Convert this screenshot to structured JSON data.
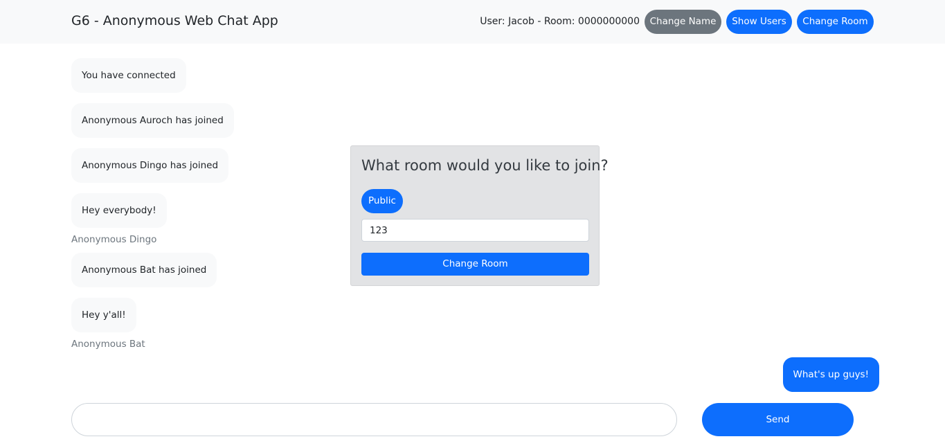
{
  "header": {
    "title": "G6 - Anonymous Web Chat App",
    "user_info": "User: Jacob - Room: 0000000000",
    "change_name_label": "Change Name",
    "show_users_label": "Show Users",
    "change_room_label": "Change Room"
  },
  "messages": [
    {
      "text": "You have connected"
    },
    {
      "text": "Anonymous Auroch has joined"
    },
    {
      "text": "Anonymous Dingo has joined"
    },
    {
      "text": "Hey everybody!",
      "sender": "Anonymous Dingo"
    },
    {
      "text": "Anonymous Bat has joined"
    },
    {
      "text": "Hey y'all!",
      "sender": "Anonymous Bat"
    }
  ],
  "own_message": {
    "text": "What's up guys!"
  },
  "room_dialog": {
    "title": "What room would you like to join?",
    "public_label": "Public",
    "room_value": "123",
    "submit_label": "Change Room"
  },
  "composer": {
    "value": "",
    "send_label": "Send"
  },
  "colors": {
    "primary": "#0d6efd",
    "secondary": "#6c757d",
    "navbar_bg": "#f8f9fa",
    "dialog_bg": "#e2e3e5"
  }
}
